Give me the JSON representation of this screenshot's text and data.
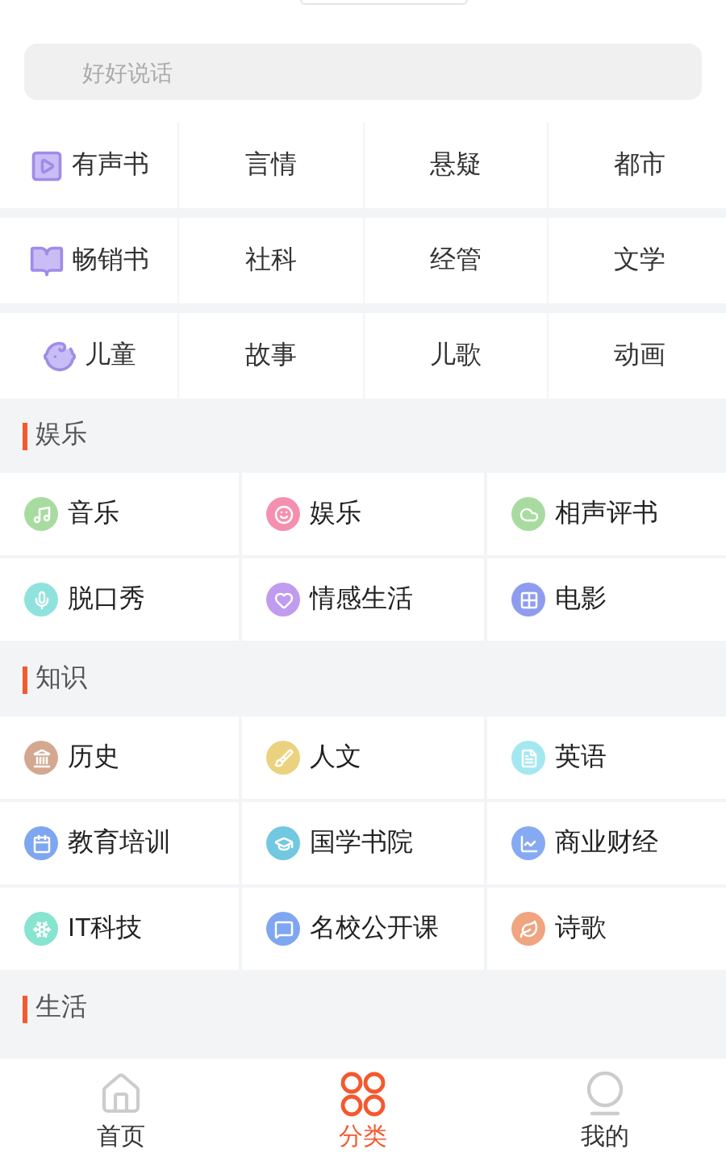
{
  "search": {
    "placeholder": "好好说话"
  },
  "top_grid": [
    {
      "items": [
        "有声书",
        "言情",
        "悬疑",
        "都市"
      ]
    },
    {
      "items": [
        "畅销书",
        "社科",
        "经管",
        "文学"
      ]
    },
    {
      "items": [
        "儿童",
        "故事",
        "儿歌",
        "动画"
      ]
    }
  ],
  "sections": [
    {
      "title": "娱乐",
      "items": [
        {
          "label": "音乐",
          "color": "#a8dba0"
        },
        {
          "label": "娱乐",
          "color": "#f58fb0"
        },
        {
          "label": "相声评书",
          "color": "#a8dba0"
        },
        {
          "label": "脱口秀",
          "color": "#8fe3dc"
        },
        {
          "label": "情感生活",
          "color": "#c19bf0"
        },
        {
          "label": "电影",
          "color": "#8e9cf0"
        }
      ]
    },
    {
      "title": "知识",
      "items": [
        {
          "label": "历史",
          "color": "#d4a890"
        },
        {
          "label": "人文",
          "color": "#ead27f"
        },
        {
          "label": "英语",
          "color": "#a3e8f0"
        },
        {
          "label": "教育培训",
          "color": "#7fa6f0"
        },
        {
          "label": "国学书院",
          "color": "#72c8e0"
        },
        {
          "label": "商业财经",
          "color": "#86aaf2"
        },
        {
          "label": "IT科技",
          "color": "#86e4cf"
        },
        {
          "label": "名校公开课",
          "color": "#7fa6f0"
        },
        {
          "label": "诗歌",
          "color": "#f0a47f"
        }
      ]
    },
    {
      "title": "生活"
    }
  ],
  "bottom_nav": [
    {
      "label": "首页",
      "selected": false
    },
    {
      "label": "分类",
      "selected": true
    },
    {
      "label": "我的",
      "selected": false
    }
  ]
}
